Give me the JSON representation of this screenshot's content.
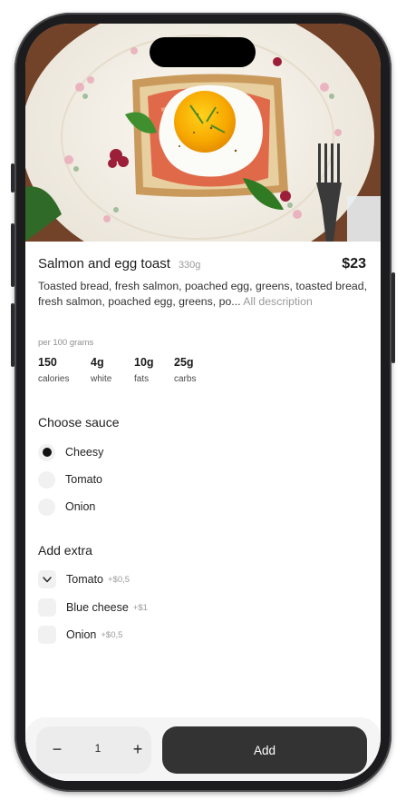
{
  "product": {
    "name": "Salmon and egg toast",
    "weight": "330g",
    "price": "$23",
    "description": "Toasted bread, fresh salmon, poached egg, greens, toasted bread, fresh salmon, poached egg, greens, po...",
    "description_more": "All description"
  },
  "nutrition": {
    "caption": "per 100 grams",
    "items": [
      {
        "value": "150",
        "label": "calories"
      },
      {
        "value": "4g",
        "label": "white"
      },
      {
        "value": "10g",
        "label": "fats"
      },
      {
        "value": "25g",
        "label": "carbs"
      }
    ]
  },
  "sauce": {
    "title": "Choose sauce",
    "options": [
      {
        "label": "Cheesy",
        "selected": true
      },
      {
        "label": "Tomato",
        "selected": false
      },
      {
        "label": "Onion",
        "selected": false
      }
    ]
  },
  "extras": {
    "title": "Add extra",
    "options": [
      {
        "label": "Tomato",
        "price": "+$0,5",
        "checked": true
      },
      {
        "label": "Blue cheese",
        "price": "+$1",
        "checked": false
      },
      {
        "label": "Onion",
        "price": "+$0,5",
        "checked": false
      }
    ]
  },
  "cart": {
    "minus": "−",
    "quantity": "1",
    "plus": "+",
    "add_label": "Add"
  },
  "colors": {
    "accent_dark": "#333333",
    "muted_text": "#9a9a9a",
    "control_bg": "#f1f1f1"
  }
}
